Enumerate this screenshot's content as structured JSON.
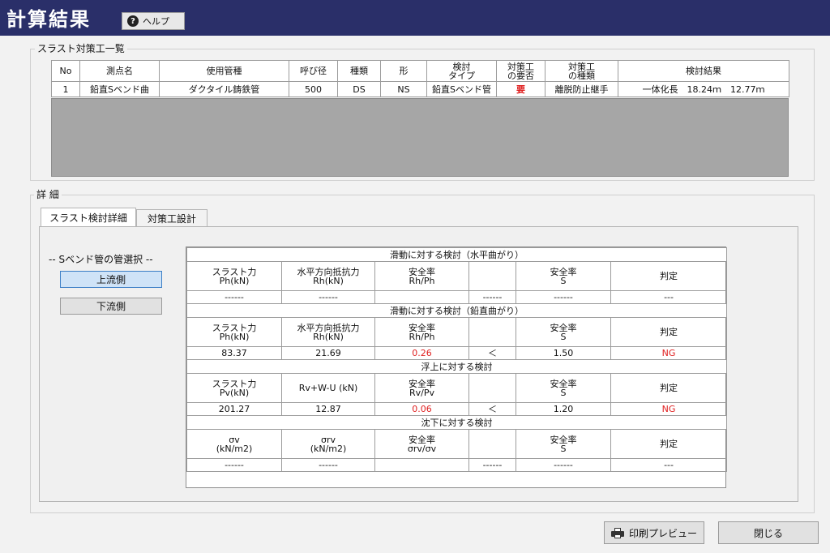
{
  "window": {
    "title": "計算結果",
    "help_label": "ヘルプ"
  },
  "summary_group": {
    "label": "スラスト対策工一覧",
    "columns": [
      "No",
      "測点名",
      "使用管種",
      "呼び径",
      "種類",
      "形",
      "検討\nタイプ",
      "対策工\nの要否",
      "対策工\nの種類",
      "検討結果"
    ],
    "rows": [
      [
        "1",
        "鉛直Sベンド曲",
        "ダクタイル鋳鉄管",
        "500",
        "DS",
        "NS",
        "鉛直Sベンド管",
        "要",
        "離脱防止継手",
        "一体化長　18.24ｍ　12.77ｍ"
      ]
    ],
    "required_color": "#e02020"
  },
  "detail_group": {
    "label": "詳 細",
    "tabs": [
      "スラスト検討詳細",
      "対策工設計"
    ],
    "active_tab": 0,
    "bend_select": {
      "label": "-- Sベンド管の管選択 --",
      "options": [
        "上流側",
        "下流側"
      ],
      "selected": "上流側"
    },
    "sections": [
      {
        "title": "滑動に対する検討（水平曲がり）",
        "headers": [
          "スラスト力\nPh(kN)",
          "水平方向抵抗力\nRh(kN)",
          "安全率\nRh/Ph",
          "",
          "安全率\nS",
          "判定"
        ],
        "values": [
          "------",
          "------",
          "",
          "------",
          "------",
          "---"
        ]
      },
      {
        "title": "滑動に対する検討（鉛直曲がり）",
        "headers": [
          "スラスト力\nPh(kN)",
          "水平方向抵抗力\nRh(kN)",
          "安全率\nRh/Ph",
          "",
          "安全率\nS",
          "判定"
        ],
        "values": [
          "83.37",
          "21.69",
          "0.26",
          "＜",
          "1.50",
          "NG"
        ]
      },
      {
        "title": "浮上に対する検討",
        "headers": [
          "スラスト力\nPv(kN)",
          "Rv+W-U (kN)",
          "安全率\nRv/Pv",
          "",
          "安全率\nS",
          "判定"
        ],
        "values": [
          "201.27",
          "12.87",
          "0.06",
          "＜",
          "1.20",
          "NG"
        ]
      },
      {
        "title": "沈下に対する検討",
        "headers": [
          "σv\n(kN/m2)",
          "σrv\n(kN/m2)",
          "安全率\nσrv/σv",
          "",
          "安全率\nS",
          "判定"
        ],
        "values": [
          "------",
          "------",
          "",
          "------",
          "------",
          "---"
        ]
      }
    ],
    "ng_color": "#e02020"
  },
  "footer": {
    "print_preview_label": "印刷プレビュー",
    "close_label": "閉じる"
  }
}
